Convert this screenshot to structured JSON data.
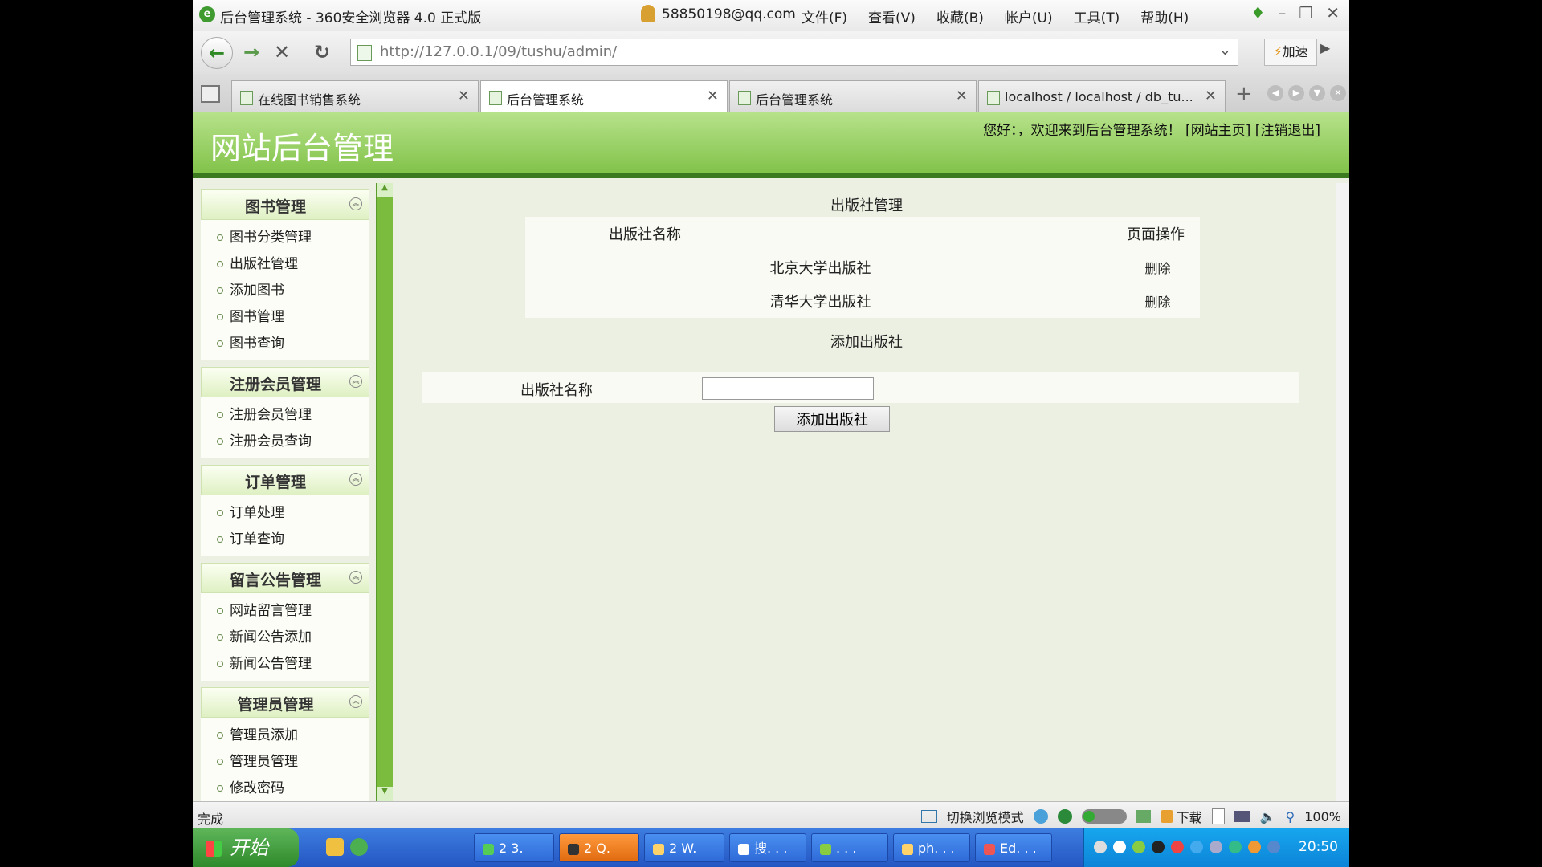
{
  "window": {
    "title": "后台管理系统 - 360安全浏览器 4.0 正式版",
    "user_email": "58850198@qq.com",
    "menu": [
      "文件(F)",
      "查看(V)",
      "收藏(B)",
      "帐户(U)",
      "工具(T)",
      "帮助(H)"
    ]
  },
  "navbar": {
    "url": "http://127.0.0.1/09/tushu/admin/",
    "speed_label": "加速"
  },
  "tabs": [
    {
      "label": "在线图书销售系统",
      "active": false
    },
    {
      "label": "后台管理系统",
      "active": true
    },
    {
      "label": "后台管理系统",
      "active": false
    },
    {
      "label": "localhost / localhost / db_tu...",
      "active": false
    }
  ],
  "header": {
    "site_title": "网站后台管理",
    "welcome": "您好：，欢迎来到后台管理系统！",
    "home_link": "网站主页",
    "logout_link": "注销退出"
  },
  "sidebar": {
    "sections": [
      {
        "title": "图书管理",
        "items": [
          "图书分类管理",
          "出版社管理",
          "添加图书",
          "图书管理",
          "图书查询"
        ]
      },
      {
        "title": "注册会员管理",
        "items": [
          "注册会员管理",
          "注册会员查询"
        ]
      },
      {
        "title": "订单管理",
        "items": [
          "订单处理",
          "订单查询"
        ]
      },
      {
        "title": "留言公告管理",
        "items": [
          "网站留言管理",
          "新闻公告添加",
          "新闻公告管理"
        ]
      },
      {
        "title": "管理员管理",
        "items": [
          "管理员添加",
          "管理员管理",
          "修改密码"
        ]
      }
    ]
  },
  "main": {
    "publisher_heading": "出版社管理",
    "columns": [
      "出版社名称",
      "页面操作"
    ],
    "rows": [
      {
        "name": "北京大学出版社",
        "action": "删除"
      },
      {
        "name": "清华大学出版社",
        "action": "删除"
      }
    ],
    "add_heading": "添加出版社",
    "add_label": "出版社名称",
    "add_value": "",
    "add_button": "添加出版社"
  },
  "statusbar": {
    "status": "完成",
    "mode_switch": "切换浏览模式",
    "download": "下载",
    "zoom": "100%"
  },
  "taskbar": {
    "start": "开始",
    "items": [
      "2 3.",
      "2 Q.",
      "2 W.",
      "搜. . .",
      ". . .",
      "ph. . .",
      "Ed. . ."
    ],
    "clock": "20:50"
  }
}
